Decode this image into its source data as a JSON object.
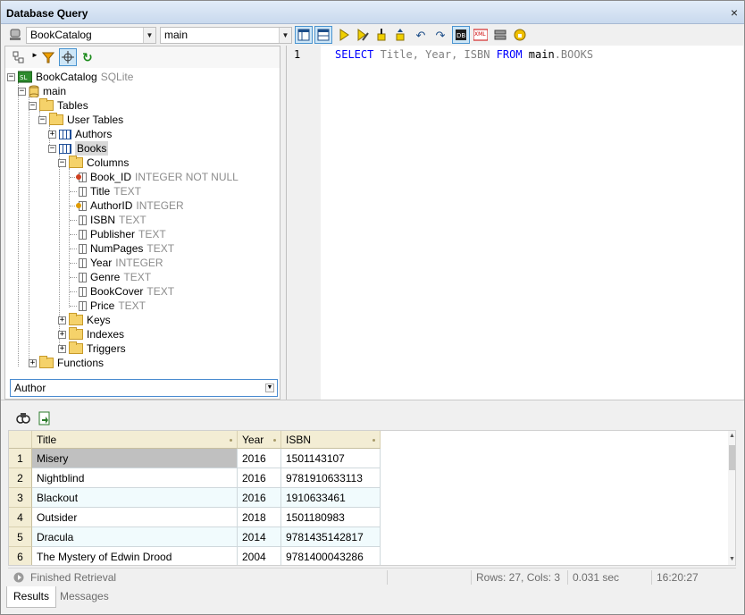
{
  "window": {
    "title": "Database Query",
    "close_glyph": "×"
  },
  "toolbar": {
    "datasource": "BookCatalog",
    "schema": "main",
    "buttons": [
      {
        "icon": "layout-horizontal-icon",
        "active": true
      },
      {
        "icon": "layout-split-icon",
        "active": true
      },
      {
        "icon": "execute-icon"
      },
      {
        "icon": "execute-edit-icon"
      },
      {
        "icon": "import-icon"
      },
      {
        "icon": "export-icon"
      },
      {
        "icon": "undo-icon"
      },
      {
        "icon": "redo-icon"
      },
      {
        "icon": "db-structure-icon",
        "active": true
      },
      {
        "icon": "xml-icon"
      },
      {
        "icon": "connect-icon"
      },
      {
        "icon": "lock-icon"
      }
    ]
  },
  "tree": {
    "root": {
      "label": "BookCatalog",
      "type": "SQLite"
    },
    "schema": "main",
    "tables_folder": "Tables",
    "user_tables_folder": "User Tables",
    "authors": "Authors",
    "books": "Books",
    "columns_folder": "Columns",
    "columns": [
      {
        "name": "Book_ID",
        "type": "INTEGER NOT NULL",
        "key": "primary"
      },
      {
        "name": "Title",
        "type": "TEXT"
      },
      {
        "name": "AuthorID",
        "type": "INTEGER",
        "key": "foreign"
      },
      {
        "name": "ISBN",
        "type": "TEXT"
      },
      {
        "name": "Publisher",
        "type": "TEXT"
      },
      {
        "name": "NumPages",
        "type": "TEXT"
      },
      {
        "name": "Year",
        "type": "INTEGER"
      },
      {
        "name": "Genre",
        "type": "TEXT"
      },
      {
        "name": "BookCover",
        "type": "TEXT"
      },
      {
        "name": "Price",
        "type": "TEXT"
      }
    ],
    "keys_folder": "Keys",
    "indexes_folder": "Indexes",
    "triggers_folder": "Triggers",
    "functions_folder": "Functions"
  },
  "filter_combo": "Author",
  "editor": {
    "line_number": "1",
    "sql": {
      "select": "SELECT",
      "cols": "Title, Year, ISBN",
      "from": "FROM",
      "schema": "main",
      "table": ".BOOKS"
    }
  },
  "results": {
    "columns": [
      "Title",
      "Year",
      "ISBN"
    ],
    "rows": [
      {
        "n": "1",
        "title": "Misery",
        "year": "2016",
        "isbn": "1501143107"
      },
      {
        "n": "2",
        "title": "Nightblind",
        "year": "2016",
        "isbn": "9781910633113"
      },
      {
        "n": "3",
        "title": "Blackout",
        "year": "2016",
        "isbn": "1910633461"
      },
      {
        "n": "4",
        "title": "Outsider",
        "year": "2018",
        "isbn": "1501180983"
      },
      {
        "n": "5",
        "title": "Dracula",
        "year": "2014",
        "isbn": "9781435142817"
      },
      {
        "n": "6",
        "title": "The Mystery of Edwin Drood",
        "year": "2004",
        "isbn": "9781400043286"
      }
    ]
  },
  "status": {
    "message": "Finished Retrieval",
    "rows_cols": "Rows: 27, Cols: 3",
    "duration": "0.031 sec",
    "time": "16:20:27"
  },
  "tabs": {
    "results": "Results",
    "messages": "Messages"
  },
  "colors": {
    "keyword": "#0000ff",
    "identifier": "#808080",
    "grid_header": "#f3edd4",
    "row_alt": "#f1fbfd"
  }
}
